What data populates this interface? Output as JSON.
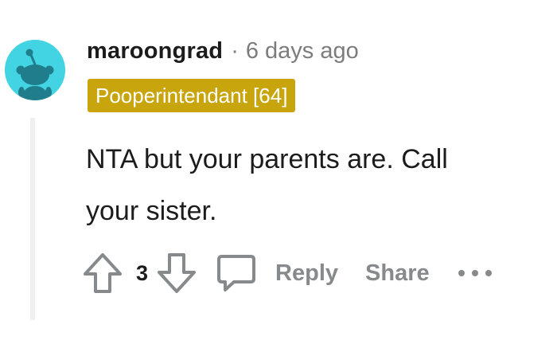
{
  "comment": {
    "username": "maroongrad",
    "separator": "·",
    "timestamp": "6 days ago",
    "flair": "Pooperintendant [64]",
    "body_lines": [
      "NTA but your parents are. Call",
      "your sister."
    ],
    "vote_count": "3",
    "actions": {
      "reply_label": "Reply",
      "share_label": "Share"
    },
    "icons": {
      "avatar": "snoo-avatar-icon",
      "upvote": "arrow-up-icon",
      "downvote": "arrow-down-icon",
      "comment": "speech-bubble-icon",
      "more": "more-dots-icon"
    },
    "colors": {
      "avatar_bg": "#43d4e3",
      "flair_bg": "#c8a50d",
      "action_gray": "#878a8c",
      "text": "#1c1c1c"
    }
  }
}
